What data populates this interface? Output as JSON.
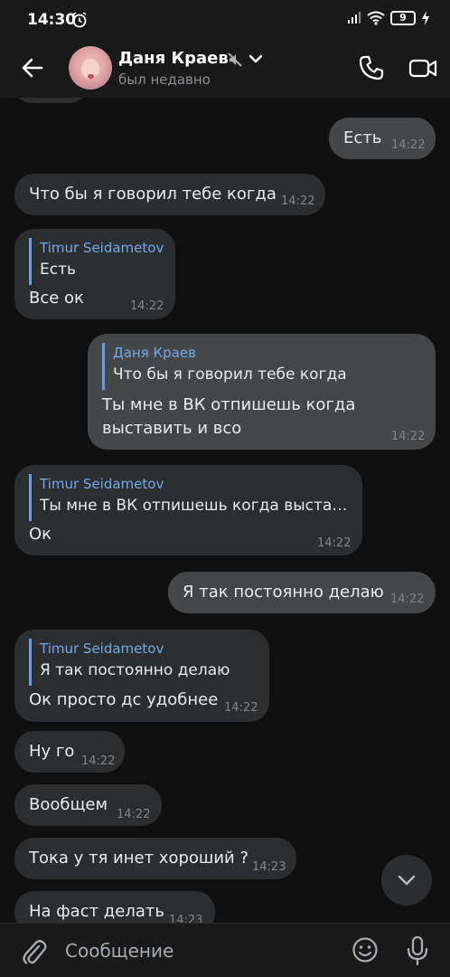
{
  "status_bar": {
    "time": "14:30",
    "battery": "9"
  },
  "header": {
    "contact_name": "Даня Краев",
    "contact_status": "был недавно"
  },
  "messages": [
    {
      "text": "Есть",
      "time": "14:22"
    },
    {
      "text": "Что бы я говорил тебе когда",
      "time": "14:22"
    },
    {
      "reply_name": "Timur Seidametov",
      "reply_text": "Есть",
      "text": "Все ок",
      "time": "14:22"
    },
    {
      "reply_name": "Даня Краев",
      "reply_text": "Что бы я говорил тебе когда",
      "text_line1": "Ты мне в ВК отпишешь когда",
      "text_line2": "выставить и всо",
      "time": "14:22"
    },
    {
      "reply_name": "Timur Seidametov",
      "reply_text": "Ты мне в ВК отпишешь когда выстав...",
      "text": "Ок",
      "time": "14:22"
    },
    {
      "text": "Я так постоянно делаю",
      "time": "14:22"
    },
    {
      "reply_name": "Timur Seidametov",
      "reply_text": "Я так постоянно делаю",
      "text": "Ок просто дс удобнее",
      "time": "14:22"
    },
    {
      "text": "Ну го",
      "time": "14:22"
    },
    {
      "text": "Вообщем",
      "time": "14:22"
    },
    {
      "text": "Тока у тя инет хороший ?",
      "time": "14:23"
    },
    {
      "text": "На фаст делать",
      "time": "14:23"
    }
  ],
  "composer": {
    "placeholder": "Сообщение"
  },
  "colors": {
    "incoming_bubble": "#2c2d2e",
    "outgoing_bubble": "#454647",
    "reply_accent": "#71aaeb",
    "background": "#0f0f0f"
  }
}
